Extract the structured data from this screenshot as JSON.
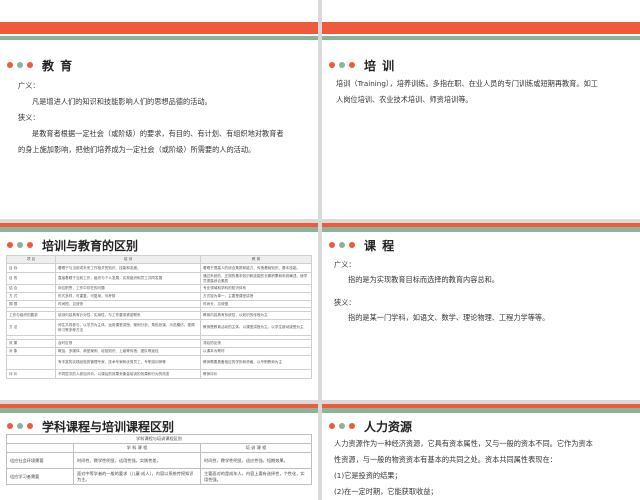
{
  "colors": {
    "accent_orange": "#ef5b3a",
    "accent_green": "#8ab39a"
  },
  "slide1": {
    "title": "教  育",
    "lines": [
      "广义：",
      "凡是增进人们的知识和技能影响人们的思想品德的活动。",
      "狭义：",
      "是教育者根据一定社会（或阶级）的要求，有目的、有计划、有组织地对教育者",
      "的身上施加影响，把他们培养成为一定社会（或阶级）所需要的人的活动。"
    ]
  },
  "slide2": {
    "title": "培  训",
    "lines": [
      "培训（Training），培养训练。多指在职、在业人员的专门训练或短期再教育。如工",
      "人岗位培训、农业技术培训、师资培训等。"
    ]
  },
  "slide3": {
    "title": "培训与教育的区别",
    "headers": [
      "项  目",
      "培  训",
      "教  育"
    ],
    "rows": [
      [
        "目  标",
        "着眼于与当前或未来工作相关的知识、技能和态度。",
        "着眼于提高人的综合素质和能力，传授基础知识、基本技能。"
      ],
      [
        "目  的",
        "直接着眼于当前工作，组织与个人发展，实现组织和员工共同发展",
        "通过系统的、正规的基本知识和技能的长期积累和系统阐述，使学员提高综合素质"
      ],
      [
        "结  合",
        "岗位职责，工作中存在的问题",
        "专业领域和学科的知识体系"
      ],
      [
        "方  式",
        "形式多样，可重复，可复用，可考核",
        "方式较为单一，主要是课堂讲授"
      ],
      [
        "期  限",
        "时间短，见效快",
        "时间长，见效慢"
      ],
      [
        "",
        "",
        ""
      ],
      [
        "工作与组织的要求",
        "培训内容具有针对性、实用性，与工作要求紧密联系",
        "教育内容具有系统性，以知识的传授为主"
      ],
      [
        "方  法",
        "师生共同参与，以学员为主体，运用课堂讲授、案例分析、角色扮演、示范模仿，视频练习等多种方法",
        "教师是教育活动的主体，以课堂讲授为主，以学生被动接受为主"
      ],
      [
        "",
        "",
        ""
      ],
      [
        "效  果",
        "及时反馈",
        "滞后的反馈"
      ],
      [
        "对  象",
        "概括、多媒体、典型案例、经验知识、上级等传授、团队等途径",
        "以课本为教材"
      ],
      [
        "",
        "有丰富的实践经验的管理专家、技术专家和优秀员工，专职培训师等",
        "教师需要具备相应的学历和资格，以专职教师为主"
      ],
      [
        "评  价",
        "不同层次的人参加评价，以课后的效果来衡量培训的效果和行为的改变",
        "教师评价"
      ]
    ]
  },
  "slide4": {
    "title": "课  程",
    "lines": [
      "广义：",
      "指的是为实现教育目标而选择的教育内容总和。",
      "狭义：",
      "指的是某一门学科，如语文、数学、理论物理、工程力学等等。"
    ]
  },
  "slide5": {
    "title": "学科课程与培训课程区别",
    "caption": "学科课程与培训课程区别",
    "headers": [
      "",
      "学 科 课 程",
      "培 训 课 程"
    ],
    "rows": [
      [
        "适应社会环境需要",
        "时间性、教学性明显，适用性强，实践性差。",
        "时间性，教学性明显，适应性强，短期效果。"
      ],
      [
        "适应学习者需要",
        "面对中等学者的一般的要求（儿童·成人），内容以系统传授知识为主。",
        "主要面对的是成年人，内容上要有选择性，个性化，实用性强。"
      ]
    ]
  },
  "slide6": {
    "title": "人力资源",
    "lines": [
      "人力资源作为一种经济资源，它具有资本属性，又与一般的资本不同。它作为资本",
      "性资源，与一般的物资资本有基本的共同之处。资本共同属性表现在：",
      "(1)它是投资的结果；",
      "(2)在一定时期，它能获取收益；"
    ]
  }
}
